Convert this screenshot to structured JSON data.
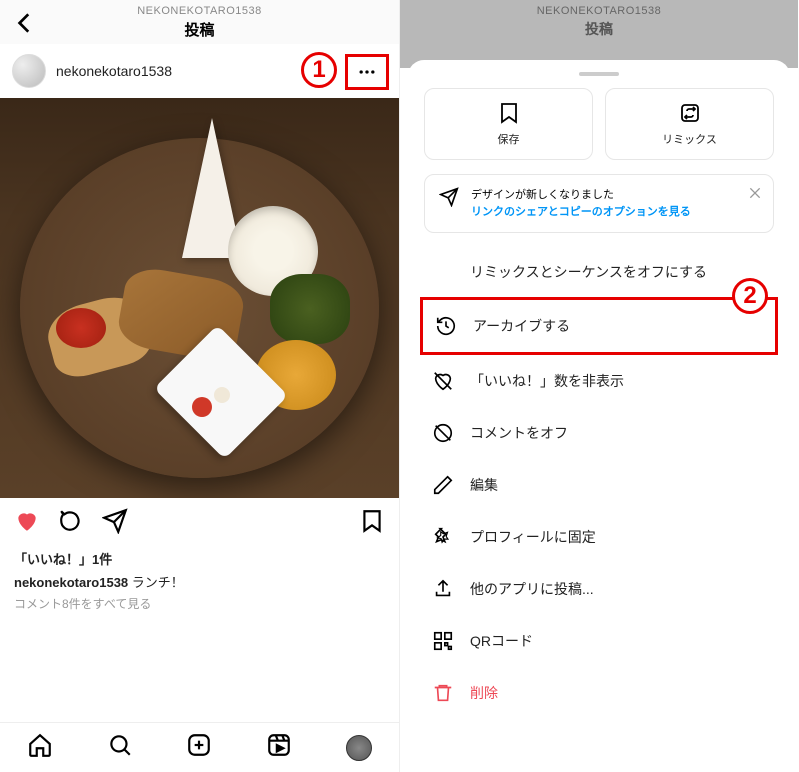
{
  "left": {
    "header_user": "NEKONEKOTARO1538",
    "header_title": "投稿",
    "username": "nekonekotaro1538",
    "likes": "「いいね！」1件",
    "caption_user": "nekonekotaro1538",
    "caption_text": "ランチ！",
    "comments_link": "コメント8件をすべて見る"
  },
  "right": {
    "header_user": "NEKONEKOTARO1538",
    "header_title": "投稿",
    "save": "保存",
    "remix": "リミックス",
    "notice_line1": "デザインが新しくなりました",
    "notice_link": "リンクのシェアとコピーのオプションを見る",
    "menu": {
      "remix_off": "リミックスとシーケンスをオフにする",
      "archive": "アーカイブする",
      "hide_likes": "「いいね！」数を非表示",
      "comments_off": "コメントをオフ",
      "edit": "編集",
      "pin": "プロフィールに固定",
      "share_other": "他のアプリに投稿...",
      "qr": "QRコード",
      "delete": "削除"
    }
  },
  "callouts": {
    "one": "1",
    "two": "2"
  }
}
